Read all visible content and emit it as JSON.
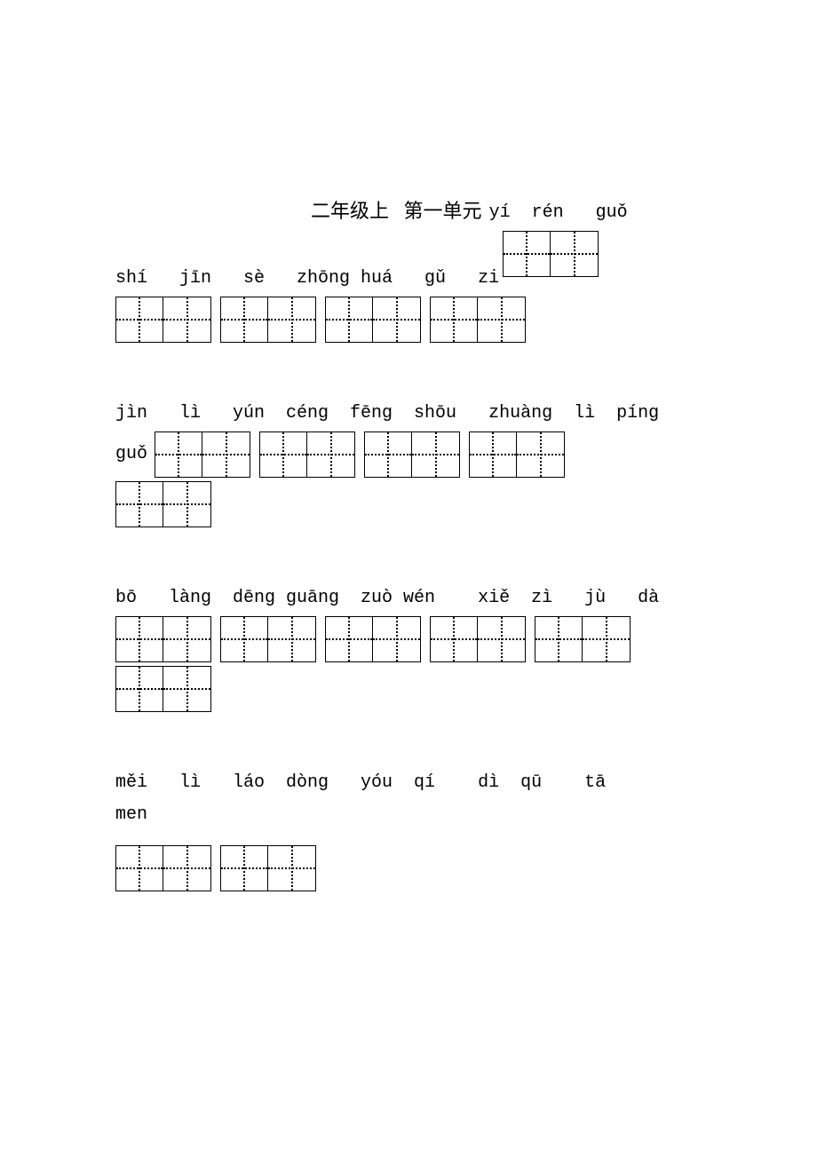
{
  "header": {
    "title": "二年级上   第一单元",
    "trailing_pinyin": "yí  rén   guǒ"
  },
  "row1": {
    "pinyin": "shí   jīn   sè   zhōng huá   gǔ   zi"
  },
  "row2": {
    "pinyin": "jìn   lì   yún  céng  fēng  shōu   zhuàng  lì  píng",
    "prefix": "guǒ"
  },
  "row3": {
    "pinyin": "bō   làng  dēng guāng  zuò wén    xiě  zì   jù   dà"
  },
  "row4": {
    "pinyin_line1": "měi   lì   láo  dòng   yóu  qí    dì  qū    tā",
    "pinyin_line2": "men"
  }
}
